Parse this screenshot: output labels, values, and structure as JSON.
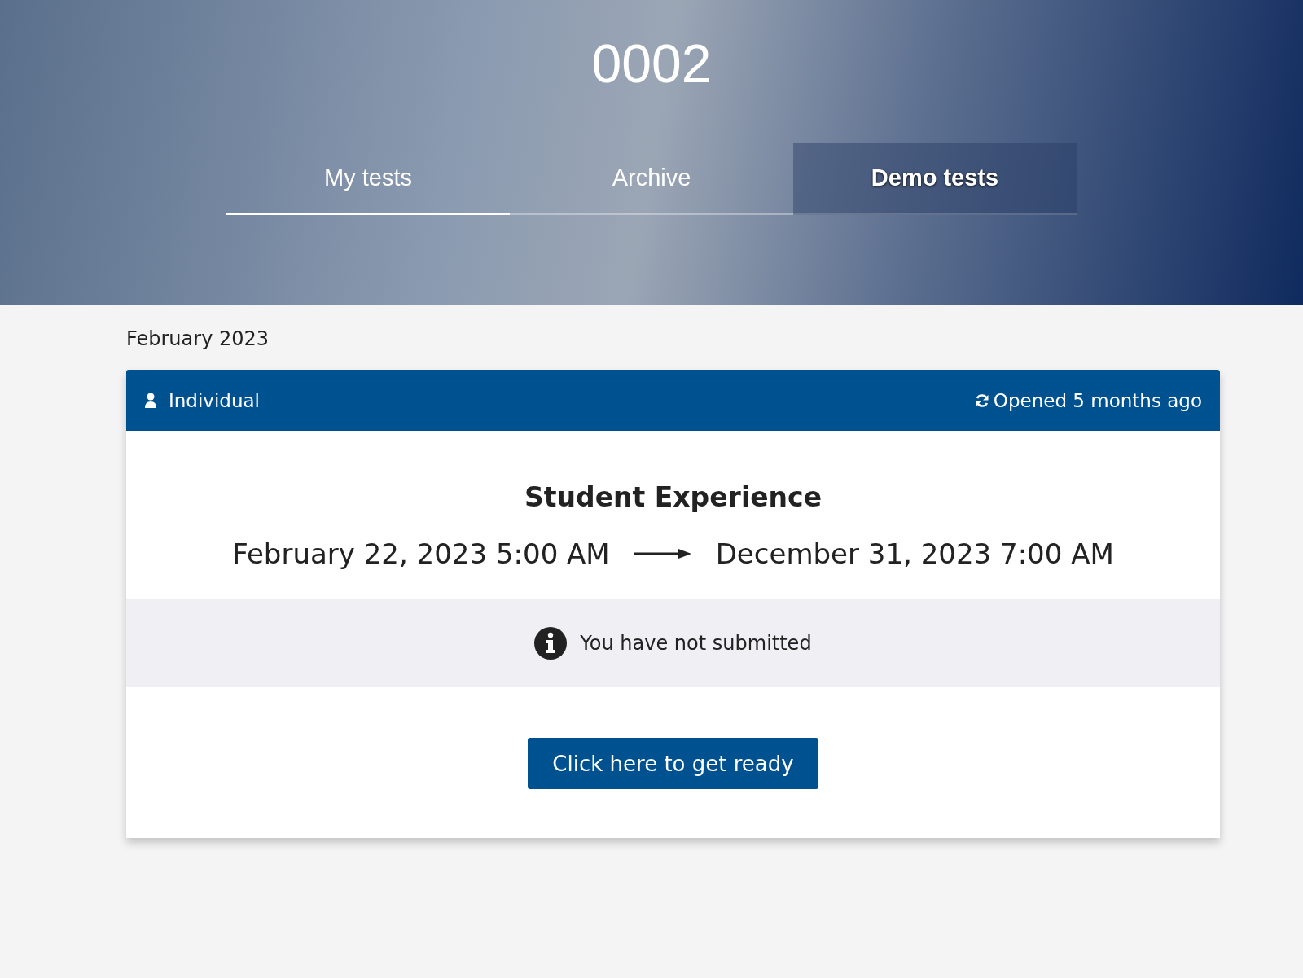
{
  "header": {
    "title": "0002"
  },
  "tabs": [
    {
      "label": "My tests",
      "selected": true,
      "highlighted": false
    },
    {
      "label": "Archive",
      "selected": false,
      "highlighted": false
    },
    {
      "label": "Demo tests",
      "selected": false,
      "highlighted": true
    }
  ],
  "section": {
    "heading": "February 2023"
  },
  "card": {
    "type_label": "Individual",
    "status": "Opened 5 months ago",
    "title": "Student Experience",
    "start": "February 22, 2023 5:00 AM",
    "end": "December 31, 2023 7:00 AM",
    "notice": "You have not submitted",
    "button": "Click here to get ready"
  }
}
